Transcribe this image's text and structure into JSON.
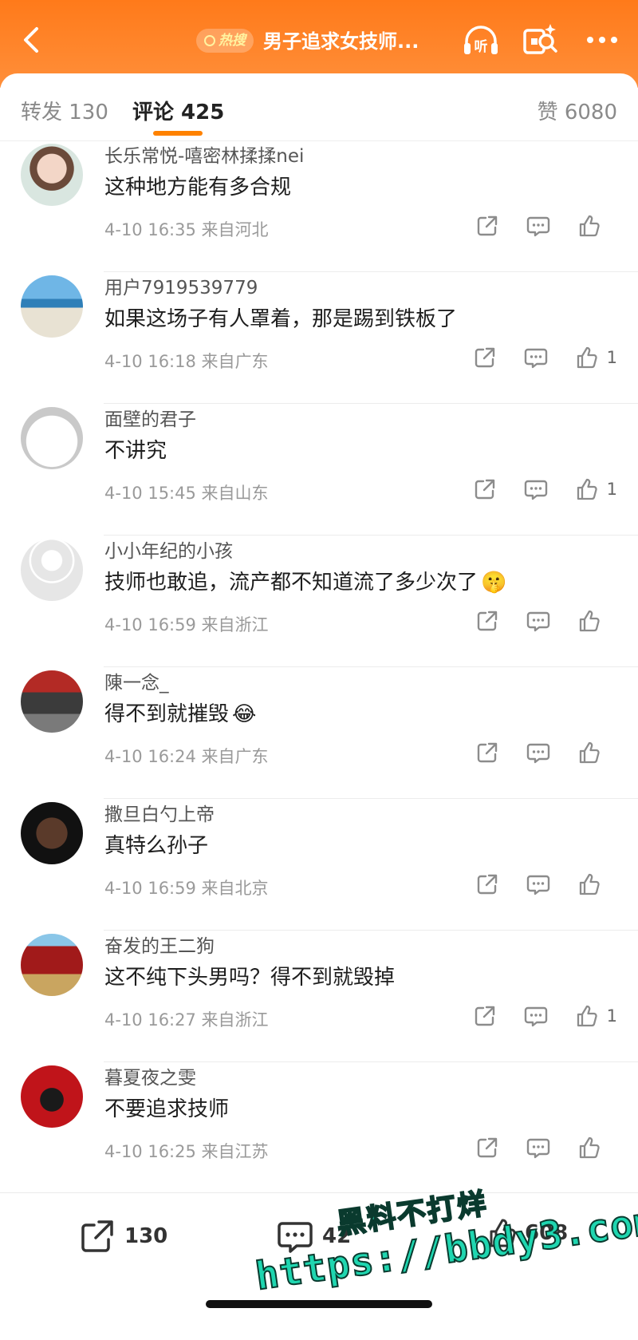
{
  "header": {
    "back_icon": "chevron-left-icon",
    "hot_badge_label": "热搜",
    "title": "男子追求女技师...",
    "listen_label": "听",
    "ai_icon": "ai-search-icon",
    "more_icon": "more-dots-icon",
    "brand_color": "#ff7a1a"
  },
  "tabs": {
    "repost_label": "转发 130",
    "comment_label": "评论 425",
    "like_label": "赞 6080"
  },
  "comments": [
    {
      "user": "长乐常悦-嘻密林揉揉nei",
      "text": "这种地方能有多合规",
      "emoji": "",
      "meta": "4-10 16:35 来自河北",
      "likes": ""
    },
    {
      "user": "用户7919539779",
      "text": "如果这场子有人罩着，那是踢到铁板了",
      "emoji": "",
      "meta": "4-10 16:18 来自广东",
      "likes": "1"
    },
    {
      "user": "面壁的君子",
      "text": "不讲究",
      "emoji": "",
      "meta": "4-10 15:45 来自山东",
      "likes": "1"
    },
    {
      "user": "小小年纪的小孩",
      "text": "技师也敢追，流产都不知道流了多少次了",
      "emoji": "🤫",
      "meta": "4-10 16:59 来自浙江",
      "likes": ""
    },
    {
      "user": "陳一念_",
      "text": "得不到就摧毁",
      "emoji": "😂",
      "meta": "4-10 16:24 来自广东",
      "likes": ""
    },
    {
      "user": "撒旦白勺上帝",
      "text": "真特么孙子",
      "emoji": "",
      "meta": "4-10 16:59 来自北京",
      "likes": ""
    },
    {
      "user": "奋发的王二狗",
      "text": "这不纯下头男吗？得不到就毁掉",
      "emoji": "",
      "meta": "4-10 16:27 来自浙江",
      "likes": "1"
    },
    {
      "user": "暮夏夜之雯",
      "text": "不要追求技师",
      "emoji": "",
      "meta": "4-10 16:25 来自江苏",
      "likes": ""
    }
  ],
  "bottom": {
    "repost_count": "130",
    "comment_count": "42",
    "like_count": "608"
  },
  "watermark": {
    "line1": "黑料不打烊",
    "line2": "https://bbdy3.com"
  }
}
